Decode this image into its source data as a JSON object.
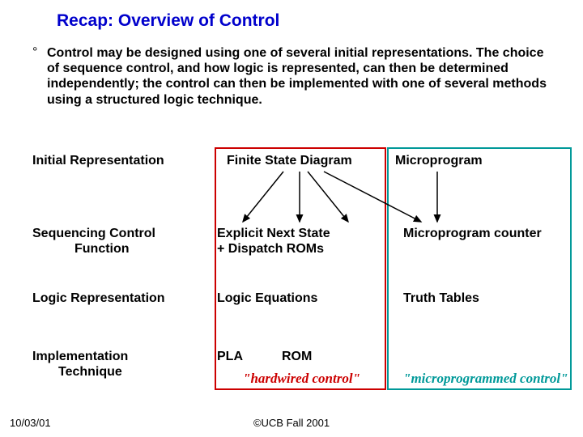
{
  "title": "Recap: Overview of Control",
  "bullet": "°",
  "paragraph": "Control may be designed using one of several initial representations. The choice of sequence control, and how logic is represented, can then be determined independently; the control can then be implemented with one of several methods using a structured logic technique.",
  "rows": {
    "r1": "Initial Representation",
    "r2a": "Sequencing Control",
    "r2b": "Function",
    "r3": "Logic Representation",
    "r4a": "Implementation",
    "r4b": "Technique"
  },
  "colA": {
    "r1": "Finite State Diagram",
    "r2a": "Explicit Next State",
    "r2b": "+ Dispatch ROMs",
    "r3": "Logic Equations",
    "r4_pla": "PLA",
    "r4_rom": "ROM",
    "tag": "\"hardwired control\""
  },
  "colB": {
    "r1": "Microprogram",
    "r2": "Microprogram counter",
    "r3": "Truth Tables",
    "tag": "\"microprogrammed control\""
  },
  "footer": {
    "date": "10/03/01",
    "copyright": "©UCB Fall 2001"
  }
}
